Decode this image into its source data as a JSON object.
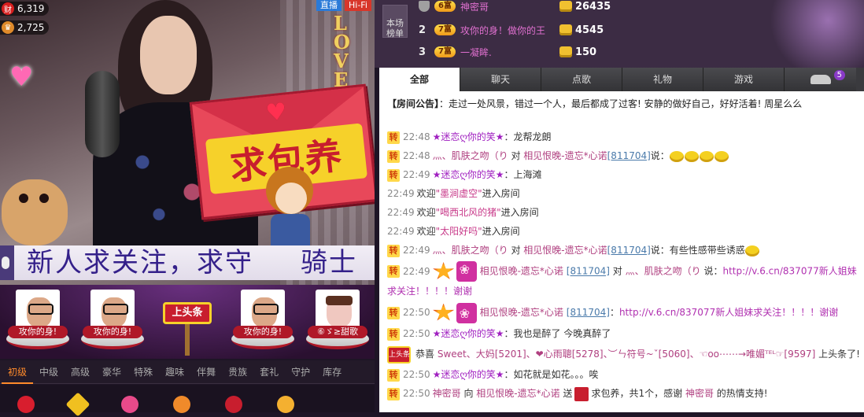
{
  "video": {
    "wealth_icon": "财",
    "wealth_value": "6,319",
    "fans_value": "2,725",
    "live_badge": "直播",
    "hifi_badge": "Hi-Fi",
    "envelope_text": "求包养",
    "banner_text": "新人求关注，求守",
    "banner_text_tail": "骑士"
  },
  "cards": [
    {
      "name": "攻你的身!"
    },
    {
      "name": "攻你的身!"
    },
    {
      "name": "攻你的身!"
    },
    {
      "name": "⑥ゞ≥甜歌"
    }
  ],
  "headline_sign": "上头条",
  "gift_tabs": [
    "初级",
    "中级",
    "高级",
    "豪华",
    "特殊",
    "趣味",
    "伴舞",
    "贵族",
    "套礼",
    "守护",
    "库存"
  ],
  "rank": {
    "label_line1": "本场",
    "label_line2": "榜单",
    "rows": [
      {
        "num": "",
        "badge": "6富",
        "name": "神密哥",
        "score": "26435"
      },
      {
        "num": "2",
        "badge": "7富",
        "name": "攻你的身！做你的王",
        "score": "4545"
      },
      {
        "num": "3",
        "badge": "7富",
        "name": "一凝眸.",
        "score": "150"
      }
    ]
  },
  "chat_tabs": [
    "全部",
    "聊天",
    "点歌",
    "礼物",
    "游戏"
  ],
  "car_count": "5",
  "chat": {
    "announce_tag": "【房间公告】",
    "announce_text": "：走过一处风景，错过一个人，最后都成了过客! 安静的做好自己，好好活着! 周星么么",
    "zhuan": "转",
    "messages": {
      "m1": {
        "time": "22:48",
        "name": "★迷恋ღ你的笑★",
        "text": "：龙帮龙朗"
      },
      "m2": {
        "time": "22:48",
        "name": "灬、肌肤之吻（り",
        "dui": "对",
        "target": "相见恨晚-遗忘*心诺",
        "uid": "[811704]",
        "said": "说："
      },
      "m3": {
        "time": "22:49",
        "name": "★迷恋ღ你的笑★",
        "text": "：上海滩"
      },
      "m4": {
        "time": "22:49",
        "welcome": "欢迎",
        "name": "\"墨涧虚空\"",
        "enter": "进入房间"
      },
      "m5": {
        "time": "22:49",
        "welcome": "欢迎",
        "name": "\"喝西北风的猪\"",
        "enter": "进入房间"
      },
      "m6": {
        "time": "22:49",
        "welcome": "欢迎",
        "name": "\"太阳好吗\"",
        "enter": "进入房间"
      },
      "m7": {
        "time": "22:49",
        "name": "灬、肌肤之吻（り",
        "dui": "对",
        "target": "相见恨晚-遗忘*心诺",
        "uid": "[811704]",
        "said": "说：有些性感带些诱惑"
      },
      "m8": {
        "time": "22:49",
        "name": "相见恨晚-遗忘*心诺",
        "uid": "[811704]",
        "dui": "对",
        "target": "灬、肌肤之吻（り",
        "said": "说：",
        "link": "http://v.6.cn/837077新人姐妹求关注！！！！谢谢"
      },
      "m9": {
        "time": "22:50",
        "name": "相见恨晚-遗忘*心诺",
        "uid": "[811704]",
        "said": "：",
        "link": "http://v.6.cn/837077新人姐妹求关注！！！！谢谢"
      },
      "m10": {
        "time": "22:50",
        "name": "★迷恋ღ你的笑★",
        "text": "：我也是醉了 今晚真醉了"
      },
      "m11": {
        "time": "22:50",
        "congrats": "恭喜",
        "names": "Sweet、大妈[5201]、❤心雨聰[5278]、︶ㄣ符号~ˇ[5060]、☜oo⋯⋯→唯媚ᵀᴱᴸ☞[9597]",
        "text": "上头条了!"
      },
      "m12": {
        "time": "22:50",
        "name": "★迷恋ღ你的笑★",
        "text": "：如花就是如花。。。唉"
      },
      "m13": {
        "time": "22:50",
        "sender": "神密哥",
        "xiang": "向",
        "target": "相见恨晚-遗忘*心诺",
        "send": "送",
        "text": "求包养，共1个，感谢",
        "thanks_name": "神密哥",
        "tail": "的热情支持!"
      }
    }
  }
}
